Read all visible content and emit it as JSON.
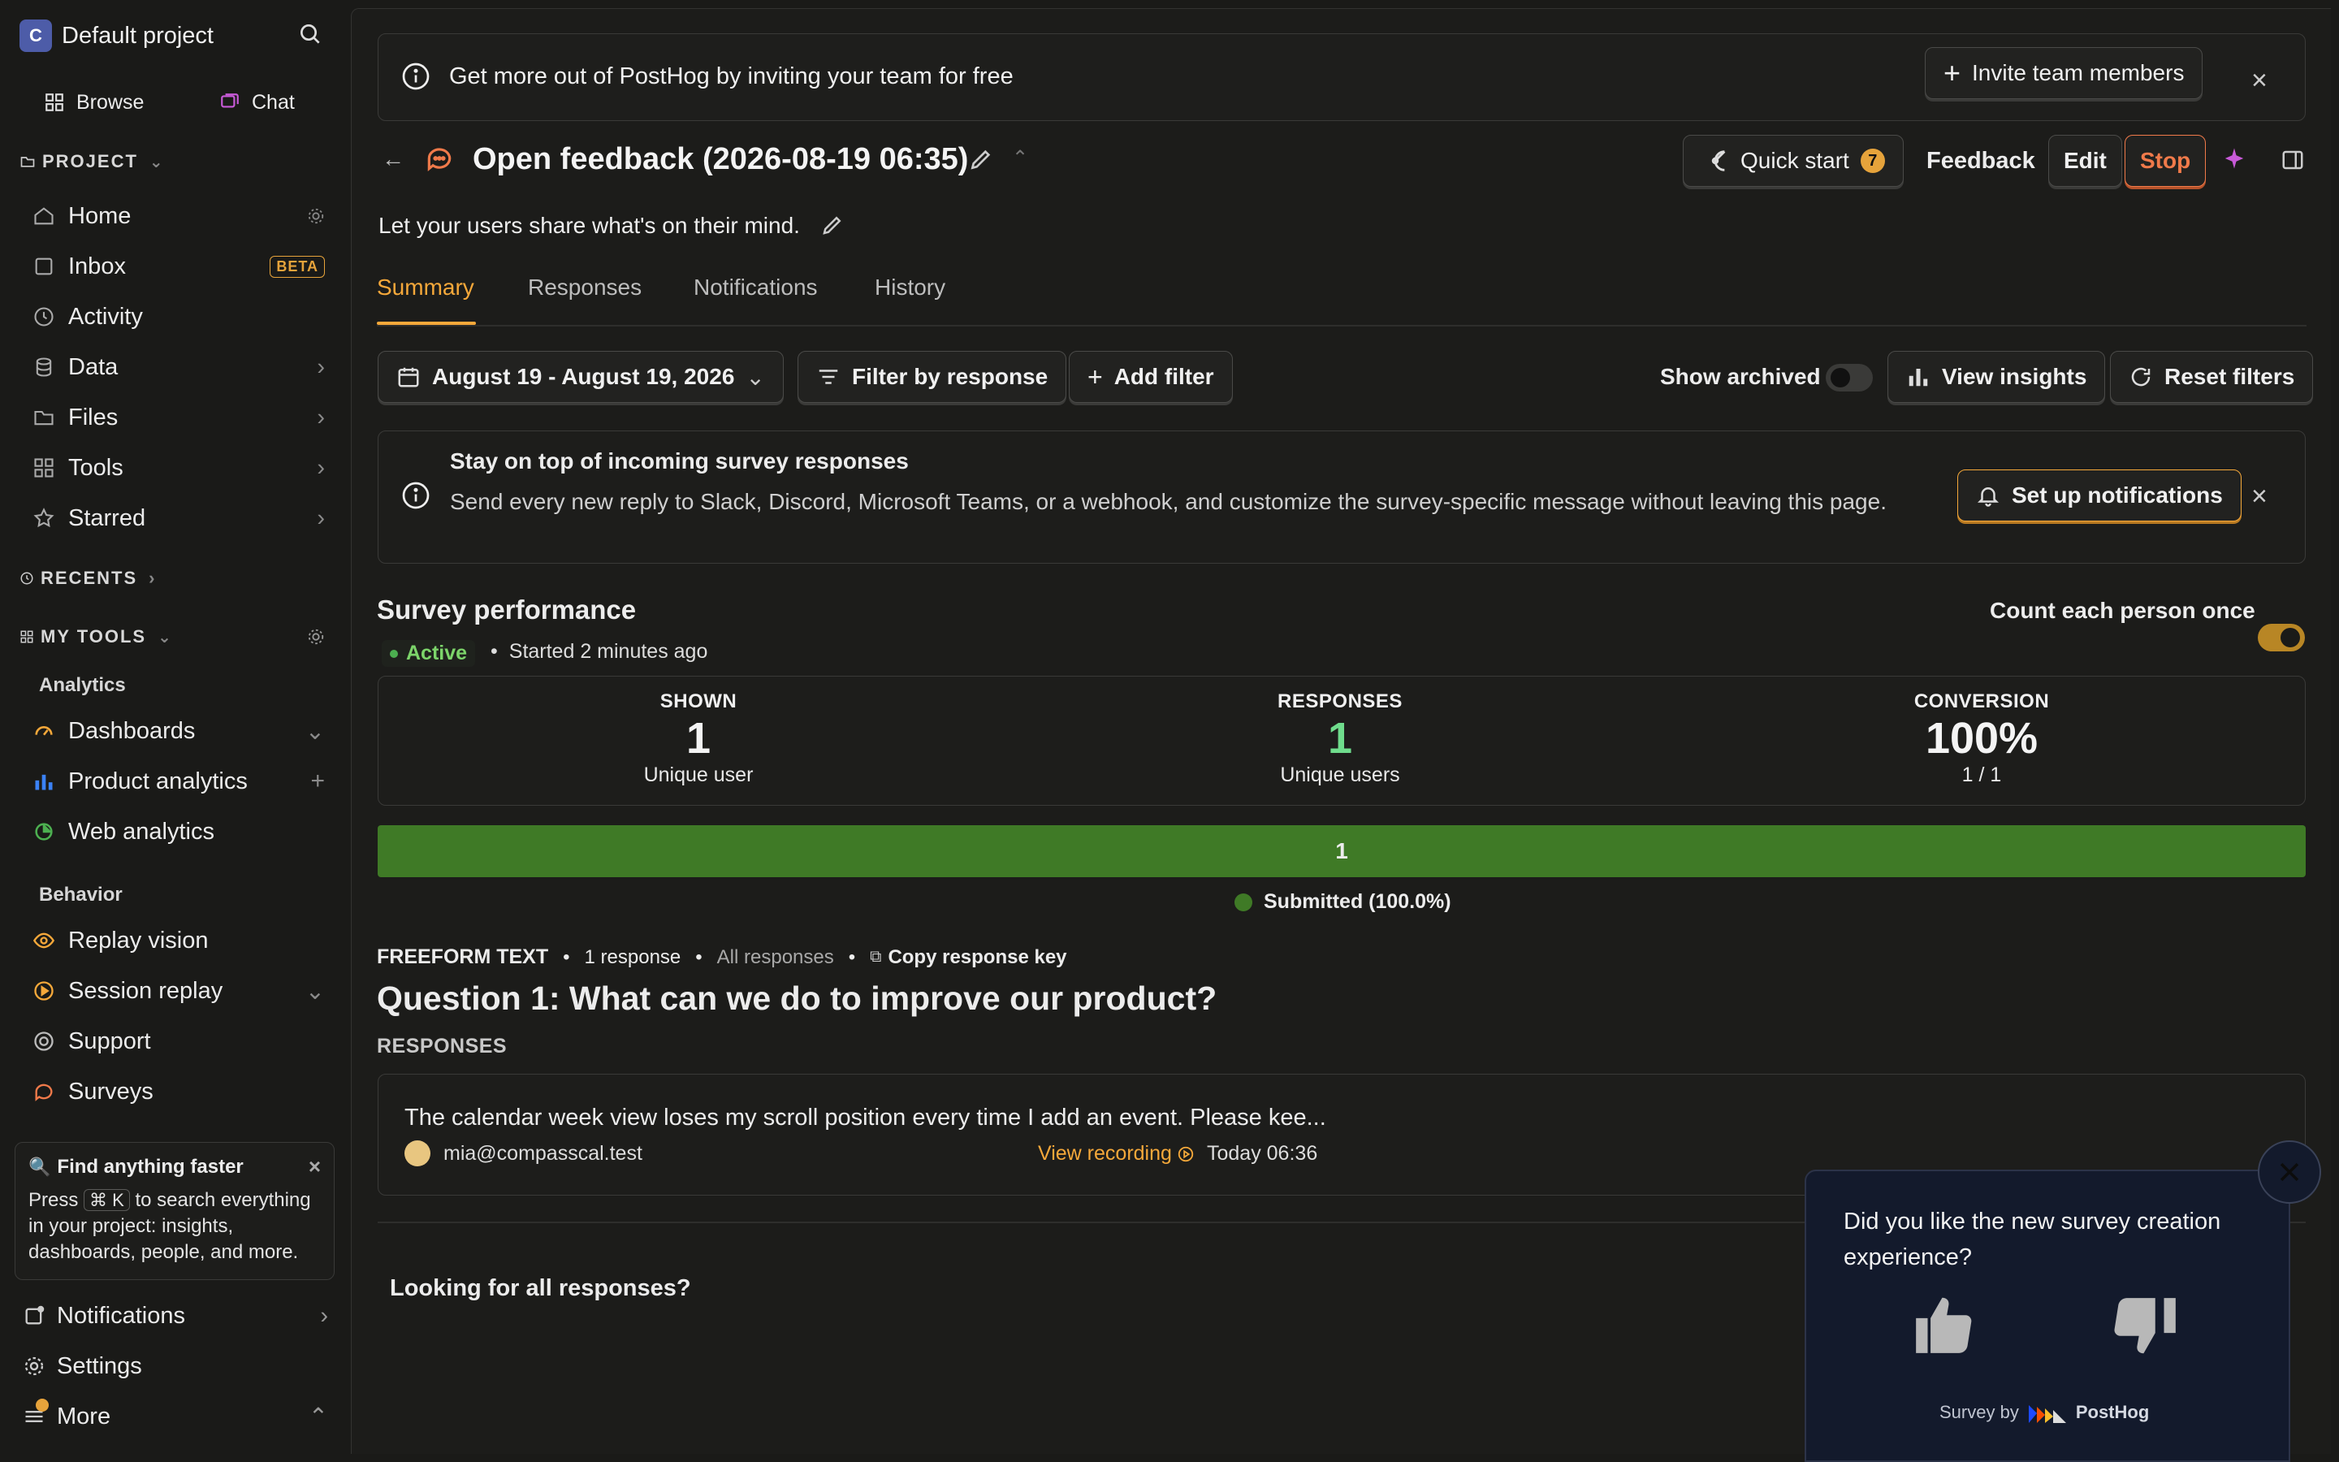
{
  "sidebar": {
    "project_initial": "C",
    "project_name": "Default project",
    "modes": [
      "Browse",
      "Chat"
    ],
    "project_section": "PROJECT",
    "nav": [
      {
        "label": "Home"
      },
      {
        "label": "Inbox",
        "badge": "BETA"
      },
      {
        "label": "Activity"
      },
      {
        "label": "Data"
      },
      {
        "label": "Files"
      },
      {
        "label": "Tools"
      },
      {
        "label": "Starred"
      }
    ],
    "recents_section": "RECENTS",
    "mytools_section": "MY TOOLS",
    "analytics_heading": "Analytics",
    "analytics_items": [
      "Dashboards",
      "Product analytics",
      "Web analytics"
    ],
    "behavior_heading": "Behavior",
    "behavior_items": [
      "Replay vision",
      "Session replay",
      "Support",
      "Surveys"
    ],
    "tip": {
      "title": "Find anything faster",
      "press": "Press",
      "kbd": "⌘ K",
      "body_rest": "to search everything in your project: insights, dashboards, people, and more."
    },
    "bottom": [
      "Notifications",
      "Settings",
      "More"
    ]
  },
  "banner": {
    "text": "Get more out of PostHog by inviting your team for free",
    "button": "Invite team members"
  },
  "header": {
    "title": "Open feedback (2026-08-19 06:35)",
    "quick_start": "Quick start",
    "quick_start_count": "7",
    "feedback": "Feedback",
    "edit": "Edit",
    "stop": "Stop",
    "description": "Let your users share what's on their mind."
  },
  "tabs": [
    "Summary",
    "Responses",
    "Notifications",
    "History"
  ],
  "filters": {
    "date_range": "August 19 - August 19, 2026",
    "filter_by_response": "Filter by response",
    "add_filter": "Add filter",
    "show_archived": "Show archived",
    "view_insights": "View insights",
    "reset_filters": "Reset filters"
  },
  "notify_card": {
    "title": "Stay on top of incoming survey responses",
    "body": "Send every new reply to Slack, Discord, Microsoft Teams, or a webhook, and customize the survey-specific message without leaving this page.",
    "button": "Set up notifications"
  },
  "performance": {
    "title": "Survey performance",
    "count_once": "Count each person once",
    "status": "Active",
    "started": "Started 2 minutes ago",
    "stats": [
      {
        "label": "SHOWN",
        "value": "1",
        "sub": "Unique user"
      },
      {
        "label": "RESPONSES",
        "value": "1",
        "sub": "Unique users"
      },
      {
        "label": "CONVERSION",
        "value": "100%",
        "sub": "1 / 1"
      }
    ],
    "bar_value": "1",
    "bar_fill_fraction": 1.0,
    "legend": "Submitted (100.0%)"
  },
  "question": {
    "type": "FREEFORM TEXT",
    "count": "1 response",
    "all": "All responses",
    "copy_key": "Copy response key",
    "title": "Question 1: What can we do to improve our product?",
    "responses_label": "RESPONSES",
    "response_text": "The calendar week view loses my scroll position every time I add an event. Please kee...",
    "email": "mia@compasscal.test",
    "view_recording": "View recording",
    "time": "Today 06:36",
    "looking_for": "Looking for all responses?"
  },
  "widget": {
    "question": "Did you like the new survey creation experience?",
    "survey_by": "Survey by",
    "brand": "PostHog"
  },
  "colors": {
    "accent": "#f5a83a",
    "active_green": "#4caf50",
    "bar_green": "#3f7a26",
    "stop": "#f07a4a"
  }
}
